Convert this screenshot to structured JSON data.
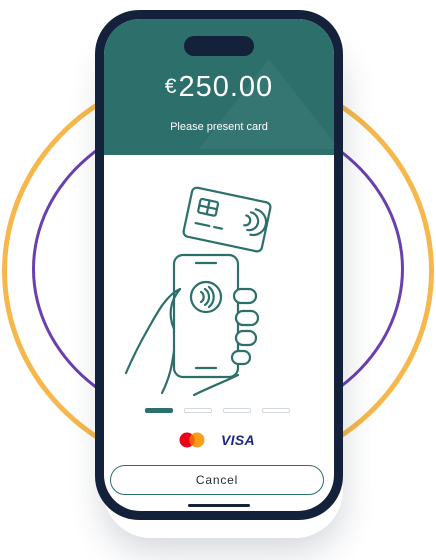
{
  "colors": {
    "header": "#2C6F6B",
    "accent": "#2C6F6B",
    "phone_frame": "#14213a",
    "ring_outer": "#F6B84C",
    "ring_inner": "#6A3FB0"
  },
  "payment": {
    "currency_symbol": "€",
    "amount": "250.00",
    "instruction": "Please present card"
  },
  "illustration": {
    "icon": "hand-holding-phone-tap-card-icon"
  },
  "progress": {
    "steps": 4,
    "current_step": 1
  },
  "brands": {
    "mastercard_icon": "mastercard-logo-icon",
    "visa_label": "VISA"
  },
  "actions": {
    "cancel_label": "Cancel"
  }
}
